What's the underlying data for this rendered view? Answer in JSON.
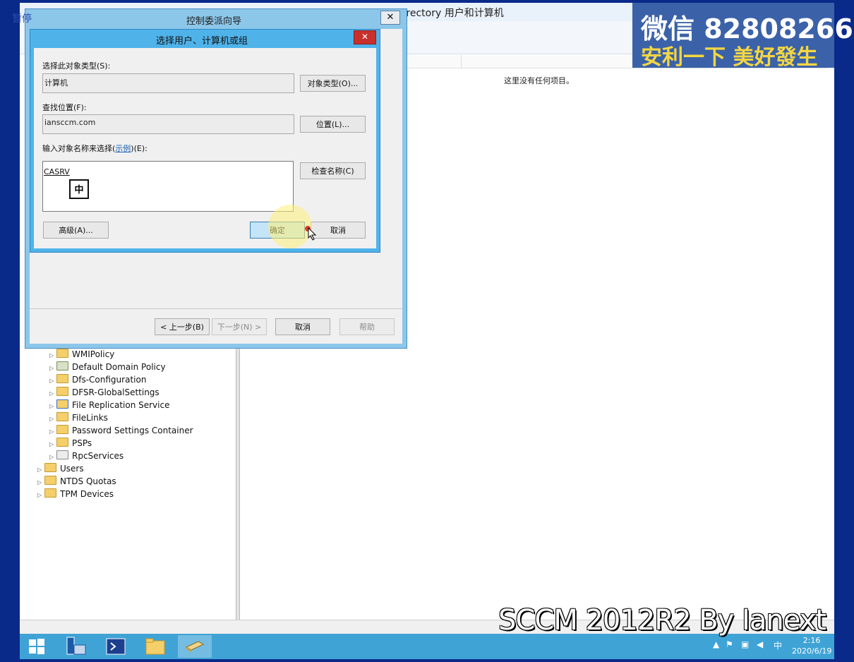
{
  "ad_window": {
    "title": "Active Directory 用户和计算机",
    "empty_message": "这里没有任何项目。"
  },
  "tree": {
    "items": [
      {
        "label": "WMIPolicy",
        "icon": "folder"
      },
      {
        "label": "Default Domain Policy",
        "icon": "gpo"
      },
      {
        "label": "Dfs-Configuration",
        "icon": "folder"
      },
      {
        "label": "DFSR-GlobalSettings",
        "icon": "folder"
      },
      {
        "label": "File Replication Service",
        "icon": "frs"
      },
      {
        "label": "FileLinks",
        "icon": "folder"
      },
      {
        "label": "Password Settings Container",
        "icon": "folder"
      },
      {
        "label": "PSPs",
        "icon": "folder"
      },
      {
        "label": "RpcServices",
        "icon": "rpc"
      },
      {
        "label": "Users",
        "icon": "folder"
      },
      {
        "label": "NTDS Quotas",
        "icon": "folder"
      },
      {
        "label": "TPM Devices",
        "icon": "folder"
      }
    ]
  },
  "wizard": {
    "title": "控制委派向导",
    "close": "✕",
    "back_label": "< 上一步(B)",
    "next_label": "下一步(N) >",
    "cancel_label": "取消",
    "help_label": "帮助"
  },
  "select_dialog": {
    "title": "选择用户、计算机或组",
    "close": "✕",
    "object_type_label": "选择此对象类型(S):",
    "object_type_value": "计算机",
    "object_types_button": "对象类型(O)...",
    "location_label": "查找位置(F):",
    "location_value": "iansccm.com",
    "locations_button": "位置(L)...",
    "names_label_prefix": "输入对象名称来选择(",
    "names_label_link": "示例",
    "names_label_suffix": ")(E):",
    "names_value": "CASRV",
    "check_names_button": "检查名称(C)",
    "advanced_button": "高级(A)...",
    "ok_button": "确定",
    "cancel_button": "取消",
    "ime_indicator": "中"
  },
  "taskbar": {
    "ime": "中",
    "time": "2:16",
    "date": "2020/6/19"
  },
  "overlay": {
    "banner_line1": "微信 82808266",
    "banner_line2": "安利一下 美好發生",
    "pause_label": "暂停",
    "watermark": "SCCM 2012R2 By Ianext"
  },
  "colors": {
    "wizard_frame": "#8cc7ea",
    "dialog_frame": "#4fb3ea",
    "taskbar": "#3fa3d6",
    "banner_bg": "#3b62a8",
    "banner_accent": "#f5d642"
  }
}
